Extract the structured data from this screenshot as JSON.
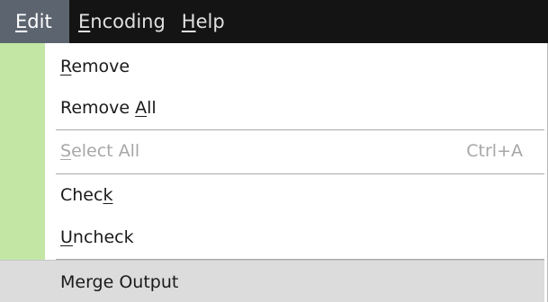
{
  "menubar": {
    "items": [
      {
        "pre": "",
        "mn": "E",
        "post": "dit"
      },
      {
        "pre": "",
        "mn": "E",
        "post": "ncoding"
      },
      {
        "pre": "",
        "mn": "H",
        "post": "elp"
      }
    ]
  },
  "menu": {
    "items": [
      {
        "pre": "",
        "mn": "R",
        "post": "emove",
        "shortcut": "",
        "disabled": false
      },
      {
        "pre": "Remove ",
        "mn": "A",
        "post": "ll",
        "shortcut": "",
        "disabled": false
      },
      {
        "pre": "",
        "mn": "S",
        "post": "elect All",
        "shortcut": "Ctrl+A",
        "disabled": true
      },
      {
        "pre": "Chec",
        "mn": "k",
        "post": "",
        "shortcut": "",
        "disabled": false
      },
      {
        "pre": "",
        "mn": "U",
        "post": "ncheck",
        "shortcut": "",
        "disabled": false
      },
      {
        "pre": "Merge Output",
        "mn": "",
        "post": "",
        "shortcut": "",
        "disabled": false
      }
    ]
  },
  "colors": {
    "menubar_bg": "#141414",
    "menubar_active_bg": "#5c6470",
    "gutter": "#c3e6a5",
    "disabled_text": "#a7a7a7",
    "highlight_bg": "#dcdcdc"
  }
}
